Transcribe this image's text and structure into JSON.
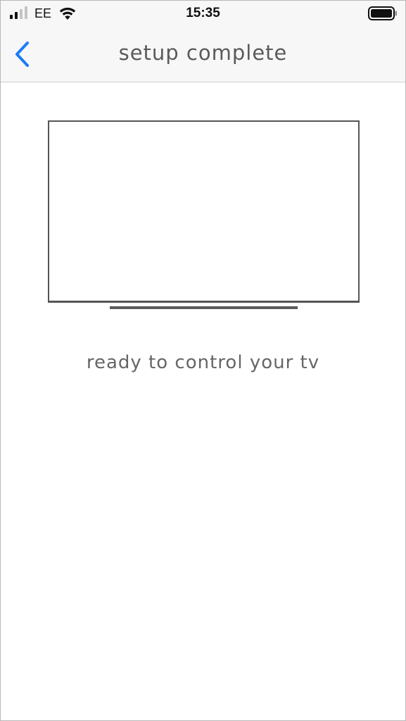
{
  "status_bar": {
    "carrier": "EE",
    "time": "15:35",
    "signal_icon": "signal-strength-icon",
    "wifi_icon": "wifi-icon",
    "battery_icon": "battery-icon"
  },
  "nav": {
    "title": "setup complete",
    "back_icon": "chevron-left-icon",
    "accent_color": "#1a7cf5"
  },
  "main": {
    "illustration_icon": "tv-icon",
    "message": "ready to control your tv"
  }
}
